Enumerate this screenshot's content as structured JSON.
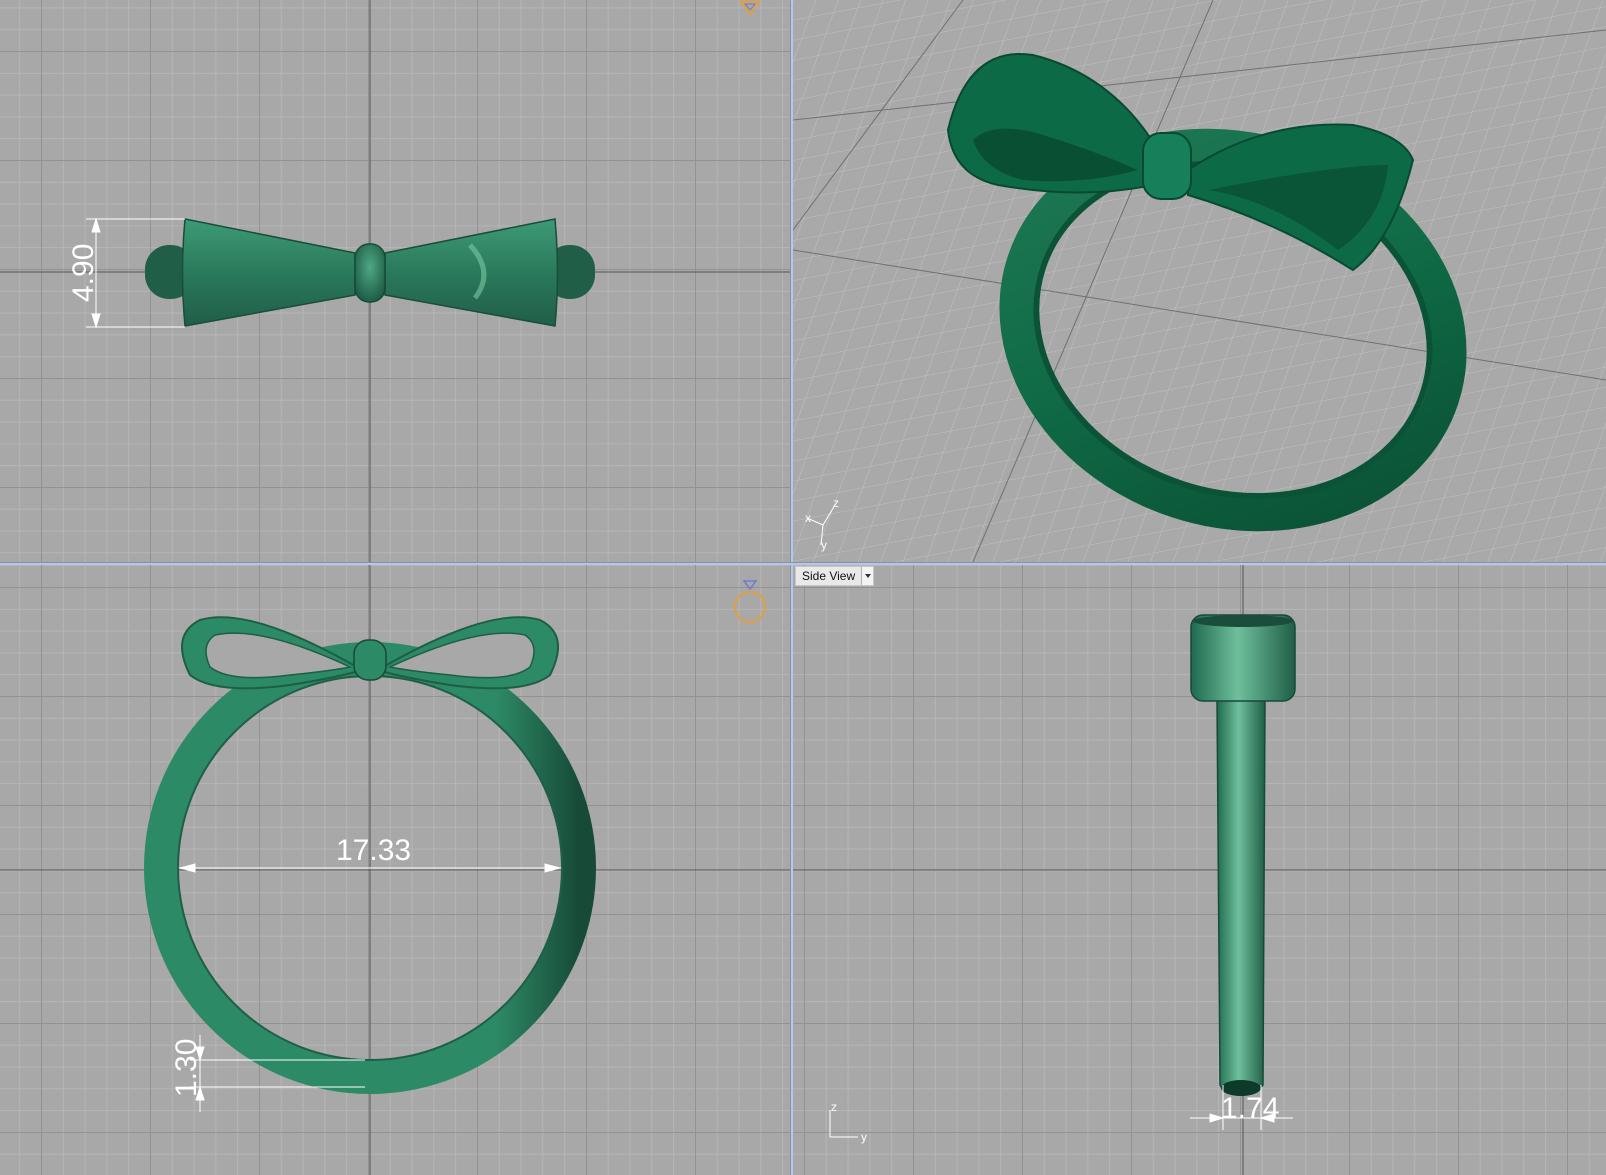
{
  "viewports": {
    "top": {
      "dimension": "4.90"
    },
    "perspective": {
      "axis": {
        "x": "x",
        "y": "y",
        "z": "z"
      }
    },
    "front": {
      "dimension_inner": "17.33",
      "dimension_thickness": "1.30"
    },
    "side": {
      "label": "Side View",
      "dimension_width": "1.74",
      "axis": {
        "y": "y",
        "z": "z"
      }
    }
  },
  "colors": {
    "model": "#2e8a68",
    "model_dark": "#1f5e47",
    "model_light": "#5fb090",
    "grid_bg": "#a8a8a8",
    "dimension_lines": "#ffffff",
    "gem_icon": "#e0a040"
  },
  "icons": {
    "ring_gem": "ring-gem-icon",
    "dropdown": "chevron-down-icon"
  }
}
